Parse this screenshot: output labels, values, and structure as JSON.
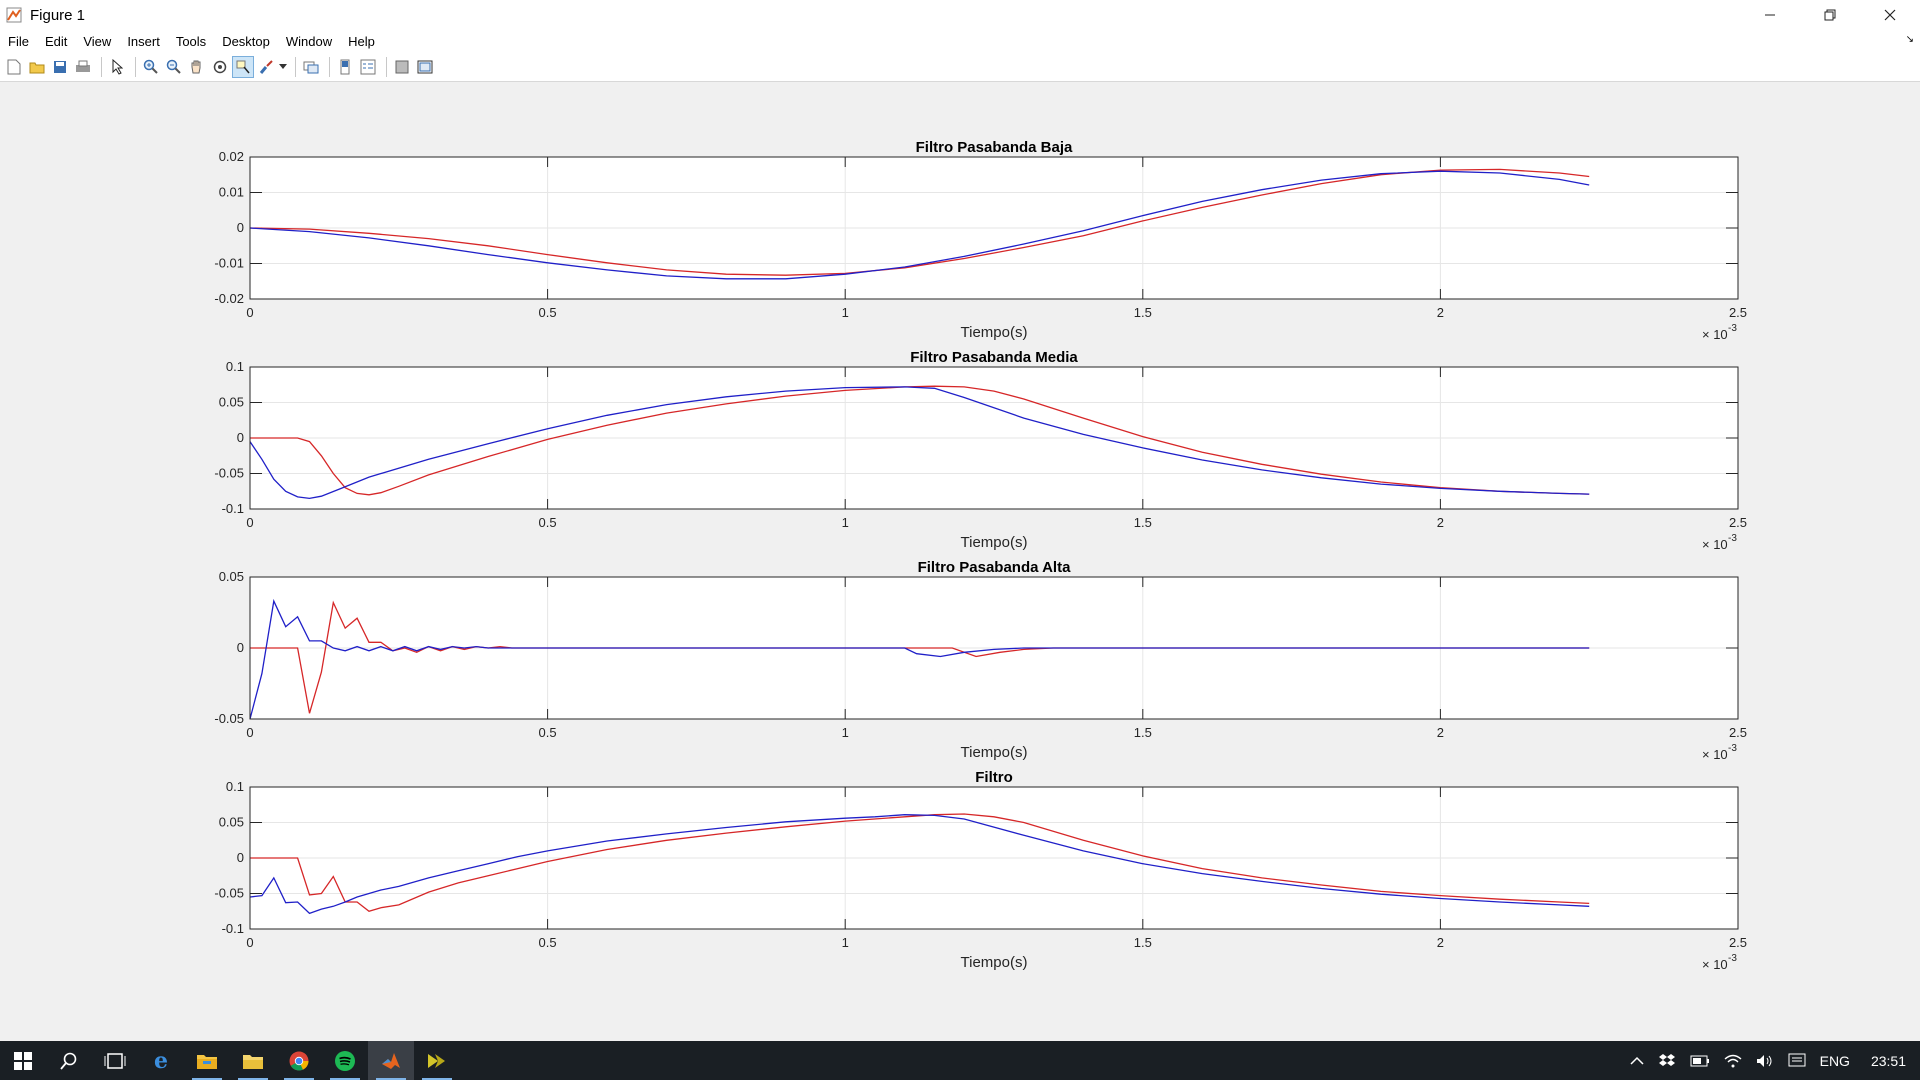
{
  "window": {
    "title": "Figure 1",
    "icon": "matlab-figure-icon",
    "controls": [
      "minimize-icon",
      "restore-icon",
      "close-icon"
    ]
  },
  "menu": [
    "File",
    "Edit",
    "View",
    "Insert",
    "Tools",
    "Desktop",
    "Window",
    "Help"
  ],
  "toolbar": {
    "buttons": [
      "new-figure-icon",
      "open-file-icon",
      "save-icon",
      "print-icon",
      "edit-plot-arrow-icon",
      "zoom-in-icon",
      "zoom-out-icon",
      "pan-hand-icon",
      "rotate-3d-icon",
      "data-cursor-icon",
      "brush-icon",
      "link-plot-icon",
      "insert-colorbar-icon",
      "insert-legend-icon",
      "hide-plot-tools-icon",
      "show-plot-tools-icon"
    ]
  },
  "colors": {
    "series_red": "#d62728",
    "series_blue": "#2020c8",
    "axes_bg": "#ffffff",
    "figure_bg": "#f0f0f0"
  },
  "chart_data": [
    {
      "type": "line",
      "title": "Filtro Pasabanda Baja",
      "xlabel": "Tiempo(s)",
      "x_exponent": "10^-3",
      "xlim": [
        0,
        2.5
      ],
      "ylim": [
        -0.02,
        0.02
      ],
      "xticks": [
        "0",
        "0.5",
        "1",
        "1.5",
        "2",
        "2.5"
      ],
      "yticks": [
        "0.02",
        "0.01",
        "0",
        "-0.01",
        "-0.02"
      ],
      "grid": true,
      "series": [
        {
          "color": "#d62728",
          "x": [
            0,
            0.1,
            0.2,
            0.3,
            0.4,
            0.5,
            0.6,
            0.7,
            0.8,
            0.9,
            1.0,
            1.1,
            1.2,
            1.3,
            1.4,
            1.5,
            1.6,
            1.7,
            1.8,
            1.9,
            2.0,
            2.1,
            2.2,
            2.25
          ],
          "y": [
            0,
            -0.0003,
            -0.0015,
            -0.003,
            -0.005,
            -0.0075,
            -0.0098,
            -0.0118,
            -0.013,
            -0.0133,
            -0.0128,
            -0.0112,
            -0.0086,
            -0.0055,
            -0.0022,
            0.002,
            0.0058,
            0.0093,
            0.0125,
            0.015,
            0.0163,
            0.0165,
            0.0155,
            0.0145
          ]
        },
        {
          "color": "#2020c8",
          "x": [
            0,
            0.1,
            0.2,
            0.3,
            0.4,
            0.5,
            0.6,
            0.7,
            0.8,
            0.9,
            1.0,
            1.1,
            1.2,
            1.3,
            1.4,
            1.5,
            1.6,
            1.7,
            1.8,
            1.9,
            2.0,
            2.1,
            2.2,
            2.25
          ],
          "y": [
            0,
            -0.001,
            -0.0028,
            -0.005,
            -0.0075,
            -0.0098,
            -0.0118,
            -0.0135,
            -0.0143,
            -0.0143,
            -0.013,
            -0.011,
            -0.008,
            -0.0045,
            -0.0008,
            0.0035,
            0.0075,
            0.0108,
            0.0135,
            0.0153,
            0.016,
            0.0155,
            0.0137,
            0.0121
          ]
        }
      ]
    },
    {
      "type": "line",
      "title": "Filtro Pasabanda Media",
      "xlabel": "Tiempo(s)",
      "x_exponent": "10^-3",
      "xlim": [
        0,
        2.5
      ],
      "ylim": [
        -0.1,
        0.1
      ],
      "xticks": [
        "0",
        "0.5",
        "1",
        "1.5",
        "2",
        "2.5"
      ],
      "yticks": [
        "0.1",
        "0.05",
        "0",
        "-0.05",
        "-0.1"
      ],
      "grid": true,
      "series": [
        {
          "color": "#d62728",
          "x": [
            0,
            0.04,
            0.08,
            0.1,
            0.12,
            0.14,
            0.16,
            0.18,
            0.2,
            0.22,
            0.25,
            0.3,
            0.4,
            0.5,
            0.6,
            0.7,
            0.8,
            0.9,
            1.0,
            1.1,
            1.15,
            1.2,
            1.25,
            1.3,
            1.4,
            1.5,
            1.6,
            1.7,
            1.8,
            1.9,
            2.0,
            2.1,
            2.2,
            2.25
          ],
          "y": [
            0,
            0,
            0,
            -0.005,
            -0.025,
            -0.05,
            -0.07,
            -0.078,
            -0.08,
            -0.077,
            -0.068,
            -0.052,
            -0.026,
            -0.002,
            0.018,
            0.035,
            0.048,
            0.059,
            0.067,
            0.072,
            0.073,
            0.072,
            0.066,
            0.055,
            0.028,
            0.002,
            -0.02,
            -0.037,
            -0.051,
            -0.062,
            -0.07,
            -0.075,
            -0.078,
            -0.079
          ]
        },
        {
          "color": "#2020c8",
          "x": [
            0,
            0.02,
            0.04,
            0.06,
            0.08,
            0.1,
            0.12,
            0.15,
            0.2,
            0.3,
            0.4,
            0.5,
            0.6,
            0.7,
            0.8,
            0.9,
            1.0,
            1.1,
            1.15,
            1.2,
            1.3,
            1.4,
            1.5,
            1.6,
            1.7,
            1.8,
            1.9,
            2.0,
            2.1,
            2.2,
            2.25
          ],
          "y": [
            -0.005,
            -0.03,
            -0.058,
            -0.075,
            -0.083,
            -0.085,
            -0.082,
            -0.072,
            -0.055,
            -0.03,
            -0.008,
            0.013,
            0.032,
            0.047,
            0.058,
            0.066,
            0.071,
            0.072,
            0.07,
            0.057,
            0.028,
            0.005,
            -0.014,
            -0.031,
            -0.045,
            -0.056,
            -0.065,
            -0.071,
            -0.075,
            -0.078,
            -0.079
          ]
        }
      ]
    },
    {
      "type": "line",
      "title": "Filtro Pasabanda Alta",
      "xlabel": "Tiempo(s)",
      "x_exponent": "10^-3",
      "xlim": [
        0,
        2.5
      ],
      "ylim": [
        -0.05,
        0.05
      ],
      "xticks": [
        "0",
        "0.5",
        "1",
        "1.5",
        "2",
        "2.5"
      ],
      "yticks": [
        "0.05",
        "0",
        "-0.05"
      ],
      "grid": true,
      "series": [
        {
          "color": "#d62728",
          "x": [
            0,
            0.04,
            0.06,
            0.08,
            0.1,
            0.12,
            0.14,
            0.16,
            0.18,
            0.2,
            0.22,
            0.24,
            0.26,
            0.28,
            0.3,
            0.32,
            0.34,
            0.36,
            0.38,
            0.4,
            0.42,
            0.44,
            0.5,
            1.0,
            1.15,
            1.18,
            1.22,
            1.26,
            1.3,
            1.35,
            1.5,
            2.0,
            2.25
          ],
          "y": [
            0,
            0,
            0,
            0,
            -0.046,
            -0.017,
            0.032,
            0.014,
            0.021,
            0.004,
            0.004,
            -0.002,
            0.0,
            -0.003,
            0.001,
            -0.002,
            0.001,
            -0.001,
            0.001,
            0.0,
            0.001,
            0.0,
            0.0,
            0.0,
            0.0,
            0.0,
            -0.006,
            -0.003,
            -0.001,
            0.0,
            0.0,
            0.0,
            0.0
          ]
        },
        {
          "color": "#2020c8",
          "x": [
            0,
            0.02,
            0.04,
            0.06,
            0.08,
            0.1,
            0.12,
            0.14,
            0.16,
            0.18,
            0.2,
            0.22,
            0.24,
            0.26,
            0.28,
            0.3,
            0.32,
            0.34,
            0.36,
            0.38,
            0.4,
            0.42,
            0.5,
            1.0,
            1.1,
            1.12,
            1.16,
            1.2,
            1.25,
            1.3,
            1.5,
            2.0,
            2.25
          ],
          "y": [
            -0.05,
            -0.018,
            0.033,
            0.015,
            0.022,
            0.005,
            0.005,
            0.0,
            -0.002,
            0.001,
            -0.002,
            0.001,
            -0.002,
            0.001,
            -0.002,
            0.001,
            -0.001,
            0.001,
            0.0,
            0.001,
            0.0,
            0.0,
            0.0,
            0.0,
            0.0,
            -0.004,
            -0.006,
            -0.003,
            -0.001,
            0.0,
            0.0,
            0.0,
            0.0
          ]
        }
      ]
    },
    {
      "type": "line",
      "title": "Filtro",
      "xlabel": "Tiempo(s)",
      "x_exponent": "10^-3",
      "xlim": [
        0,
        2.5
      ],
      "ylim": [
        -0.1,
        0.1
      ],
      "xticks": [
        "0",
        "0.5",
        "1",
        "1.5",
        "2",
        "2.5"
      ],
      "yticks": [
        "0.1",
        "0.05",
        "0",
        "-0.05",
        "-0.1"
      ],
      "grid": true,
      "series": [
        {
          "color": "#d62728",
          "x": [
            0,
            0.04,
            0.06,
            0.08,
            0.1,
            0.12,
            0.14,
            0.16,
            0.18,
            0.2,
            0.22,
            0.25,
            0.3,
            0.35,
            0.4,
            0.45,
            0.5,
            0.6,
            0.7,
            0.8,
            0.9,
            1.0,
            1.1,
            1.15,
            1.2,
            1.25,
            1.3,
            1.4,
            1.5,
            1.6,
            1.7,
            1.8,
            1.9,
            2.0,
            2.1,
            2.2,
            2.25
          ],
          "y": [
            0,
            0,
            0,
            0,
            -0.052,
            -0.05,
            -0.026,
            -0.062,
            -0.062,
            -0.075,
            -0.07,
            -0.066,
            -0.048,
            -0.035,
            -0.025,
            -0.015,
            -0.005,
            0.012,
            0.025,
            0.035,
            0.044,
            0.052,
            0.058,
            0.061,
            0.062,
            0.058,
            0.05,
            0.025,
            0.003,
            -0.015,
            -0.028,
            -0.038,
            -0.047,
            -0.053,
            -0.058,
            -0.062,
            -0.064
          ]
        },
        {
          "color": "#2020c8",
          "x": [
            0,
            0.02,
            0.04,
            0.06,
            0.08,
            0.1,
            0.12,
            0.14,
            0.16,
            0.18,
            0.2,
            0.22,
            0.25,
            0.3,
            0.35,
            0.4,
            0.45,
            0.5,
            0.6,
            0.7,
            0.8,
            0.9,
            1.0,
            1.05,
            1.1,
            1.15,
            1.2,
            1.3,
            1.4,
            1.5,
            1.6,
            1.7,
            1.8,
            1.9,
            2.0,
            2.1,
            2.2,
            2.25
          ],
          "y": [
            -0.055,
            -0.053,
            -0.028,
            -0.063,
            -0.062,
            -0.078,
            -0.072,
            -0.068,
            -0.062,
            -0.055,
            -0.05,
            -0.045,
            -0.04,
            -0.028,
            -0.018,
            -0.008,
            0.002,
            0.01,
            0.024,
            0.034,
            0.043,
            0.051,
            0.056,
            0.058,
            0.061,
            0.06,
            0.055,
            0.032,
            0.01,
            -0.008,
            -0.022,
            -0.033,
            -0.043,
            -0.051,
            -0.057,
            -0.062,
            -0.066,
            -0.068
          ]
        }
      ]
    }
  ],
  "taskbar": {
    "apps": [
      {
        "icon": "windows-start-icon",
        "open": false
      },
      {
        "icon": "search-icon",
        "open": false
      },
      {
        "icon": "task-view-icon",
        "open": false
      },
      {
        "icon": "edge-browser-icon",
        "open": false
      },
      {
        "icon": "file-explorer-icon",
        "open": true
      },
      {
        "icon": "folder-icon",
        "open": true
      },
      {
        "icon": "chrome-icon",
        "open": true
      },
      {
        "icon": "spotify-icon",
        "open": true
      },
      {
        "icon": "matlab-icon",
        "open": true
      },
      {
        "icon": "terminal-app-icon",
        "open": true
      }
    ],
    "tray": {
      "icons": [
        "chevron-up-icon",
        "dropbox-icon",
        "battery-icon",
        "wifi-icon",
        "volume-icon",
        "notifications-icon"
      ],
      "language": "ENG",
      "time": "23:51"
    }
  }
}
